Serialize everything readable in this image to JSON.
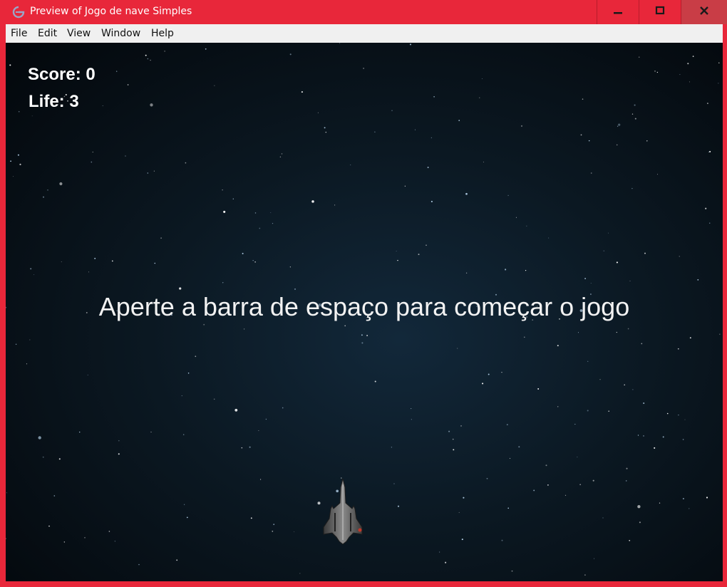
{
  "window": {
    "title": "Preview of Jogo de nave Simples",
    "app_icon": "gamemaker-icon",
    "controls": [
      "minimize-icon",
      "maximize-icon",
      "close-icon"
    ]
  },
  "menubar": {
    "items": [
      "File",
      "Edit",
      "View",
      "Window",
      "Help"
    ]
  },
  "game": {
    "score_text": "Score: 0",
    "life_text": "Life: 3",
    "start_message": "Aperte a barra de espaço para começar o jogo",
    "player_sprite": "spaceship-icon"
  },
  "colors": {
    "accent": "#e8273a",
    "close_button": "#c93d46",
    "menubar": "#f0f0f0",
    "game_background": "#0b1822",
    "hud_text": "#ffffff"
  }
}
